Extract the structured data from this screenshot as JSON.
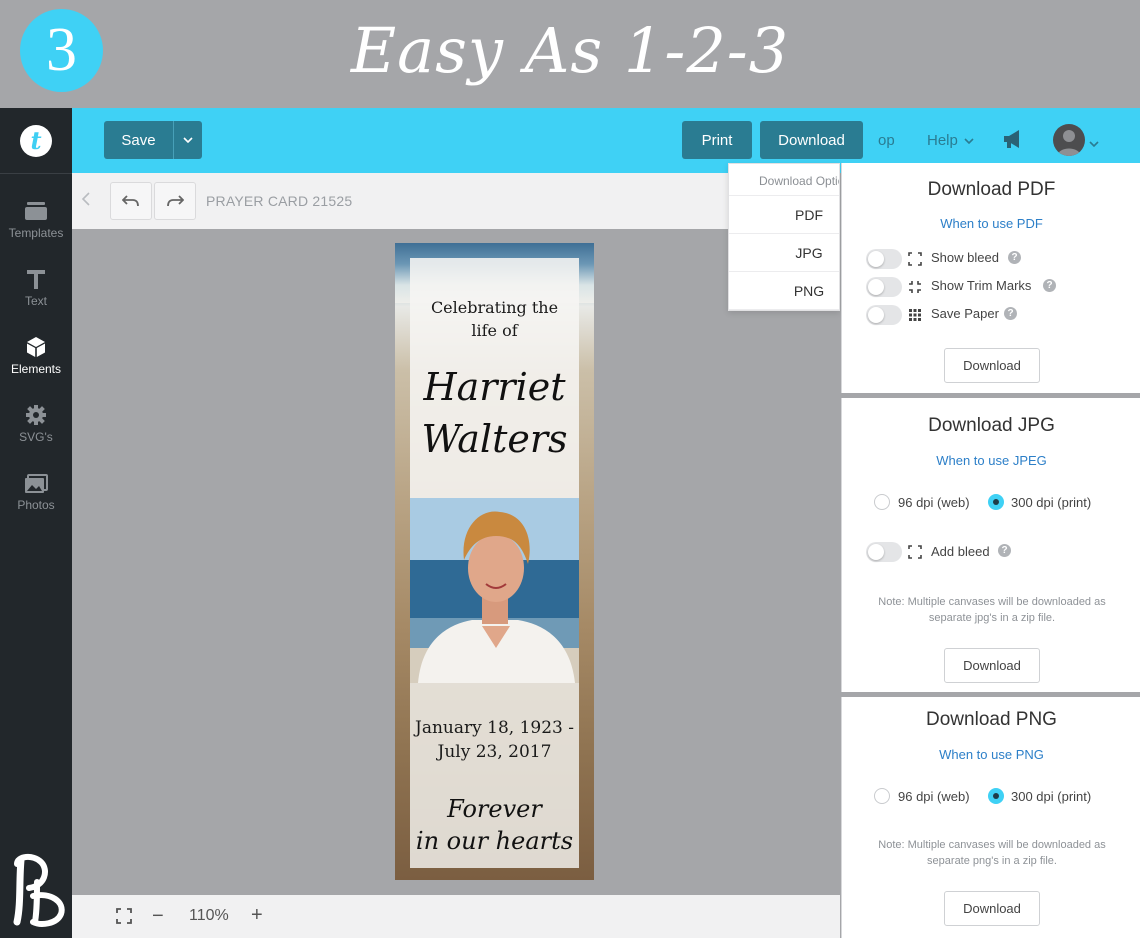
{
  "banner": {
    "step_number": "3",
    "title": "Easy As 1-2-3"
  },
  "sidebar": {
    "logo_letter": "t",
    "items": [
      {
        "label": "Templates",
        "icon": "layers-icon"
      },
      {
        "label": "Text",
        "icon": "text-icon"
      },
      {
        "label": "Elements",
        "icon": "cube-icon",
        "active": true
      },
      {
        "label": "SVG's",
        "icon": "gear-icon"
      },
      {
        "label": "Photos",
        "icon": "image-icon"
      }
    ]
  },
  "toolbar": {
    "save_label": "Save",
    "print_label": "Print",
    "download_label": "Download",
    "partial_label": "op",
    "help_label": "Help"
  },
  "subbar": {
    "document_title": "PRAYER CARD 21525"
  },
  "card": {
    "celebrating_line1": "Celebrating the",
    "celebrating_line2": "life of",
    "first_name": "Harriet",
    "last_name": "Walters",
    "date_line1": "January 18, 1923 -",
    "date_line2": "July 23, 2017",
    "closing_line1": "Forever",
    "closing_line2": "in our hearts"
  },
  "zoom": {
    "level": "110%"
  },
  "download_menu": {
    "header": "Download Options",
    "options": [
      "PDF",
      "JPG",
      "PNG"
    ]
  },
  "pdf_panel": {
    "title": "Download PDF",
    "link": "When to use PDF",
    "options": [
      {
        "label": "Show bleed",
        "icon": "bleed-icon",
        "enabled": false
      },
      {
        "label": "Show Trim Marks",
        "icon": "trim-marks-icon",
        "enabled": false
      },
      {
        "label": "Save Paper",
        "icon": "grid-icon",
        "enabled": false
      }
    ],
    "button": "Download"
  },
  "jpg_panel": {
    "title": "Download JPG",
    "link": "When to use JPEG",
    "dpi_options": [
      {
        "label": "96 dpi (web)",
        "selected": false
      },
      {
        "label": "300 dpi (print)",
        "selected": true
      }
    ],
    "bleed_label": "Add bleed",
    "note_line1": "Note: Multiple canvases will be downloaded as",
    "note_line2": "separate jpg's in a zip file.",
    "button": "Download"
  },
  "png_panel": {
    "title": "Download PNG",
    "link": "When to use PNG",
    "dpi_options": [
      {
        "label": "96 dpi (web)",
        "selected": false
      },
      {
        "label": "300 dpi (print)",
        "selected": true
      }
    ],
    "note_line1": "Note: Multiple canvases will be downloaded as",
    "note_line2": "separate png's in a zip file.",
    "button": "Download"
  },
  "colors": {
    "accent": "#3fd1f5",
    "button_dark": "#2a7c92",
    "sidebar": "#22272b",
    "link": "#2c7fc8"
  }
}
